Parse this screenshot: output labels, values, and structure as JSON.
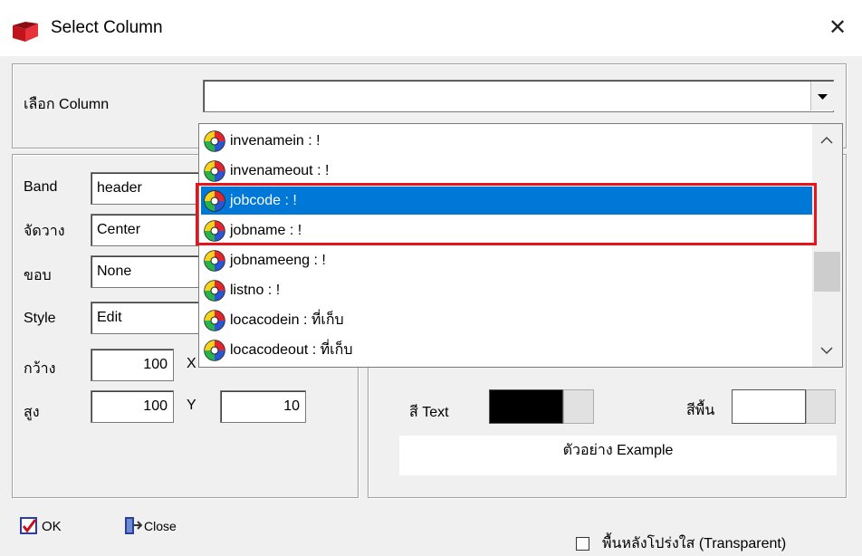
{
  "window": {
    "title": "Select Column",
    "close_glyph": "✕"
  },
  "column_select": {
    "label": "เลือก Column",
    "value": ""
  },
  "fields": {
    "band": {
      "label": "Band",
      "value": "header"
    },
    "align": {
      "label": "จัดวาง",
      "value": "Center"
    },
    "border": {
      "label": "ขอบ",
      "value": "None"
    },
    "style": {
      "label": "Style",
      "value": "Edit"
    },
    "width": {
      "label": "กว้าง",
      "value": "100",
      "axis_label": "X"
    },
    "height": {
      "label": "สูง",
      "value": "100",
      "axis_label": "Y",
      "y_value": "10"
    }
  },
  "colors": {
    "text_label": "สี Text",
    "text_color": "#000000",
    "bg_label": "สีพื้น",
    "bg_color": "#ffffff",
    "selection": "#0078d7",
    "highlight_box": "#e8141c"
  },
  "preview_text": "ตัวอย่าง Example",
  "buttons": {
    "ok": "OK",
    "close": "Close"
  },
  "transparent_label": "พื้นหลังโปร่งใส (Transparent)",
  "dropdown_items": [
    {
      "label": "invenamein : !",
      "selected": false
    },
    {
      "label": "invenameout : !",
      "selected": false
    },
    {
      "label": "jobcode : !",
      "selected": true
    },
    {
      "label": "jobname : !",
      "selected": false
    },
    {
      "label": "jobnameeng : !",
      "selected": false
    },
    {
      "label": "listno : !",
      "selected": false
    },
    {
      "label": "locacodein : ที่เก็บ",
      "selected": false
    },
    {
      "label": "locacodeout : ที่เก็บ",
      "selected": false
    }
  ]
}
